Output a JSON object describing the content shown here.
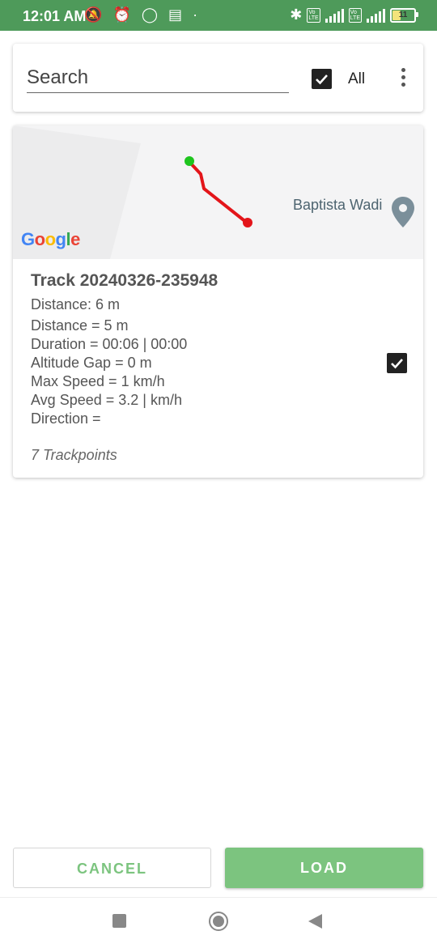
{
  "status_bar": {
    "time": "12:01 AM",
    "battery": "11"
  },
  "search": {
    "placeholder": "Search",
    "all_label": "All",
    "all_checked": true
  },
  "track": {
    "map_place_label": "Baptista Wadi",
    "map_logo": "Google",
    "title": "Track 20240326-235948",
    "distance_primary": "Distance: 6 m",
    "stats": [
      "Distance = 5 m",
      "Duration = 00:06 | 00:00",
      "Altitude Gap = 0 m",
      "Max Speed = 1 km/h",
      "Avg Speed = 3.2 | km/h",
      "Direction ="
    ],
    "trackpoints": "7 Trackpoints",
    "checked": true
  },
  "buttons": {
    "cancel": "CANCEL",
    "load": "LOAD"
  },
  "colors": {
    "status_bar": "#4e9a5a",
    "accent": "#7cc47f",
    "track_line": "#e3151a",
    "track_start": "#1ec51e"
  }
}
